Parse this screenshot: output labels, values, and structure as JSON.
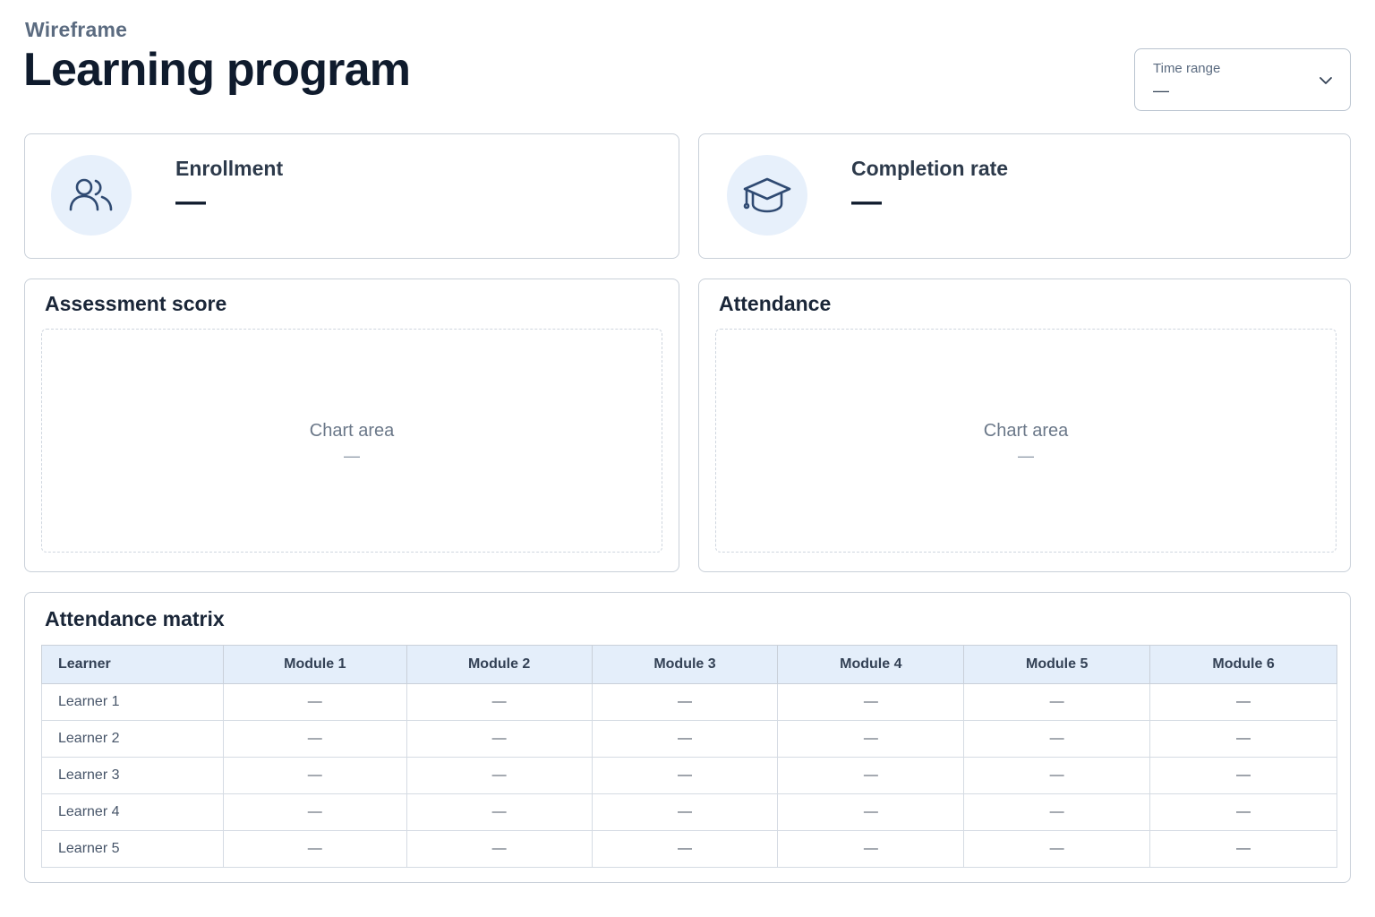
{
  "header": {
    "eyebrow": "Wireframe",
    "title": "Learning program"
  },
  "time_range": {
    "label": "Time range",
    "value": "—",
    "icon": "chevron-down-icon"
  },
  "kpis": [
    {
      "label": "Enrollment",
      "value": "—",
      "icon": "users-icon"
    },
    {
      "label": "Completion rate",
      "value": "—",
      "icon": "graduation-cap-icon"
    }
  ],
  "panels": [
    {
      "title": "Assessment score",
      "placeholder": "Chart area",
      "value": "—"
    },
    {
      "title": "Attendance",
      "placeholder": "Chart area",
      "value": "—"
    }
  ],
  "matrix": {
    "title": "Attendance matrix",
    "columns": [
      "Learner",
      "Module 1",
      "Module 2",
      "Module 3",
      "Module 4",
      "Module 5",
      "Module 6"
    ],
    "rows": [
      [
        "Learner 1",
        "—",
        "—",
        "—",
        "—",
        "—",
        "—"
      ],
      [
        "Learner 2",
        "—",
        "—",
        "—",
        "—",
        "—",
        "—"
      ],
      [
        "Learner 3",
        "—",
        "—",
        "—",
        "—",
        "—",
        "—"
      ],
      [
        "Learner 4",
        "—",
        "—",
        "—",
        "—",
        "—",
        "—"
      ],
      [
        "Learner 5",
        "—",
        "—",
        "—",
        "—",
        "—",
        "—"
      ]
    ]
  },
  "colors": {
    "accent": "#2f4a72",
    "icon_bg": "#e7f0fb",
    "header_bg": "#e4eefa",
    "border": "#c9d0d9"
  }
}
